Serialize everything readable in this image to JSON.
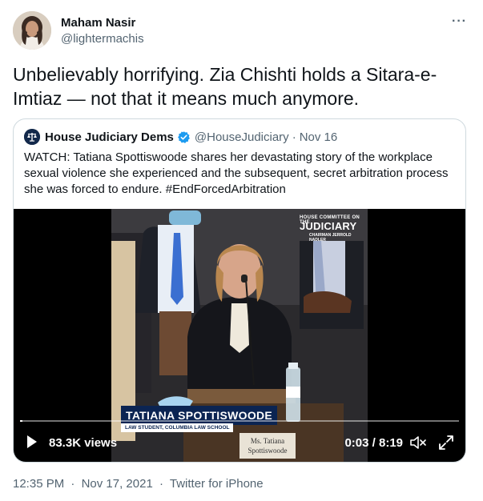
{
  "author": {
    "name": "Maham Nasir",
    "handle": "@lightermachis"
  },
  "tweet_text": "Unbelievably horrifying. Zia Chishti holds a Sitara-e-Imtiaz — not that it means much anymore.",
  "quoted": {
    "name": "House Judiciary Dems",
    "handle": "@HouseJudiciary",
    "separator": "·",
    "date": "Nov 16",
    "text": "WATCH: Tatiana Spottiswoode shares her devastating story of the workplace sexual violence she experienced and the subsequent, secret arbitration process she was forced to endure. #EndForcedArbitration",
    "video": {
      "watermark_top": "HOUSE COMMITTEE ON THE",
      "watermark_main": "JUDICIARY",
      "watermark_sub": "CHAIRMAN JERROLD NADLER",
      "lower_third_name": "TATIANA SPOTTISWOODE",
      "lower_third_title": "LAW STUDENT, COLUMBIA LAW SCHOOL",
      "nameplate_line1": "Ms. Tatiana",
      "nameplate_line2": "Spottiswoode",
      "views": "83.3K views",
      "time": "0:03 / 8:19",
      "progress_fraction": 0.006
    }
  },
  "meta": {
    "time": "12:35 PM",
    "separator": "·",
    "date": "Nov 17, 2021",
    "separator2": "·",
    "source": "Twitter for iPhone"
  },
  "colors": {
    "text": "#0f1419",
    "secondary": "#536471",
    "border": "#cfd9de",
    "verified": "#1d9bf0",
    "banner": "#0b2452"
  },
  "icons": [
    "more-icon",
    "verified-icon",
    "play-icon",
    "mute-icon",
    "fullscreen-icon"
  ]
}
